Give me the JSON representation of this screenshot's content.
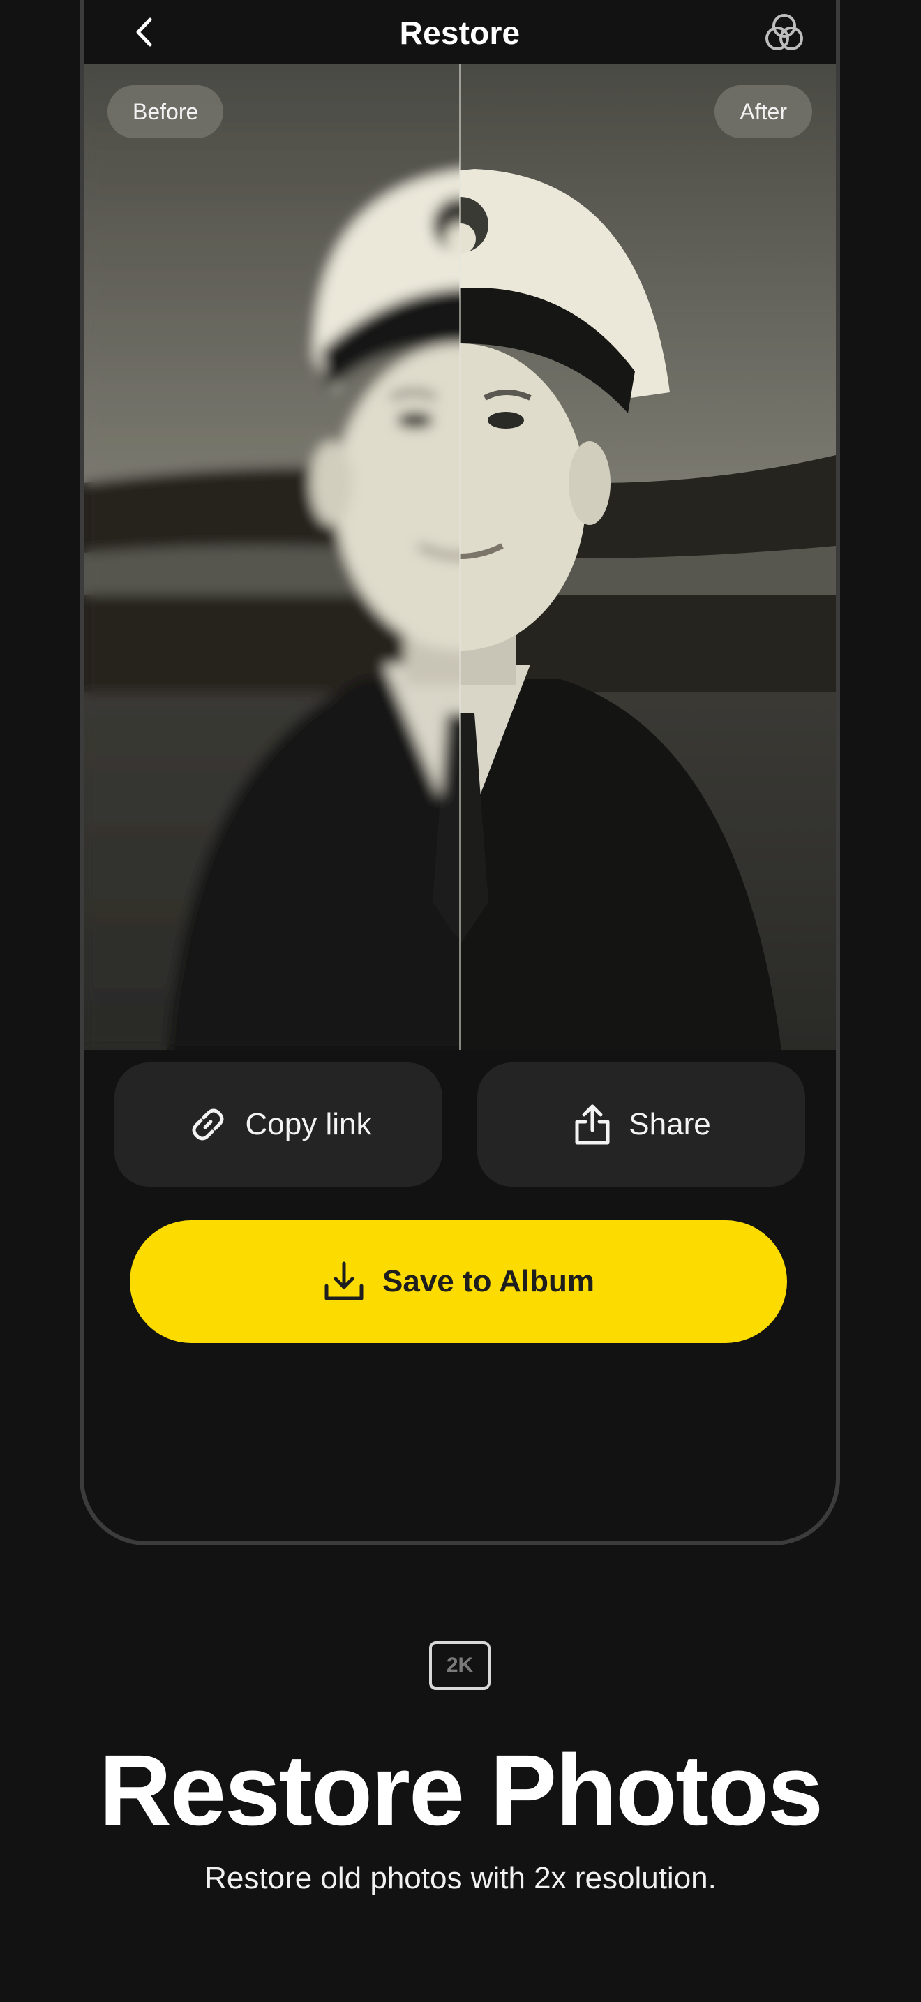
{
  "header": {
    "title": "Restore",
    "back_icon": "chevron-left-icon",
    "filters_icon": "overlapping-circles-icon"
  },
  "compare": {
    "before_label": "Before",
    "after_label": "After",
    "split_position": 0.5
  },
  "actions": {
    "copy_link_label": "Copy link",
    "copy_link_icon": "link-icon",
    "share_label": "Share",
    "share_icon": "share-icon",
    "save_label": "Save to Album",
    "save_icon": "download-icon"
  },
  "promo": {
    "badge": "2K",
    "headline": "Restore Photos",
    "subline": "Restore old photos with 2x resolution."
  },
  "colors": {
    "background": "#121212",
    "accent": "#FCDC00",
    "button_bg": "#242424"
  }
}
